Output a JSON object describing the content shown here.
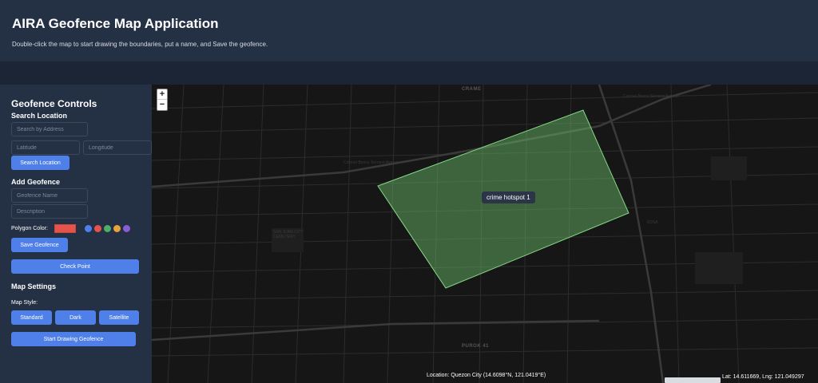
{
  "header": {
    "title": "AIRA Geofence Map Application",
    "subtitle": "Double-click the map to start drawing the boundaries, put a name, and Save the geofence."
  },
  "sidebar": {
    "title": "Geofence Controls",
    "search": {
      "heading": "Search Location",
      "address_placeholder": "Search by Address",
      "latitude_placeholder": "Latitude",
      "longitude_placeholder": "Longitude",
      "button": "Search Location"
    },
    "add": {
      "heading": "Add Geofence",
      "name_placeholder": "Geofence Name",
      "description_placeholder": "Description",
      "color_label": "Polygon Color:",
      "selected_color": "#e5534b",
      "palette": [
        "#4f80ea",
        "#e5534b",
        "#4caf6a",
        "#e9a33b",
        "#8a5cd6"
      ],
      "save_button": "Save Geofence",
      "check_button": "Check Point"
    },
    "settings": {
      "heading": "Map Settings",
      "style_label": "Map Style:",
      "styles": [
        "Standard",
        "Dark",
        "Satellite"
      ],
      "draw_button": "Start Drawing Geofence"
    }
  },
  "map": {
    "zoom_in": "+",
    "zoom_out": "−",
    "polygon_label": "crime hotspot 1",
    "polygon_fill": "#6fc36f",
    "location_text": "Location: Quezon City (14.6098°N, 121.0419°E)",
    "cursor_text": "Lat: 14.611669, Lng: 121.049297",
    "place_labels": [
      "CRAME",
      "PUROK 41",
      "SAN JUAN CITY CEMETERY"
    ],
    "street_labels": [
      "Colonel Bonny Serrano Avenue",
      "Colonel Bonny Serrano Avenue",
      "EDSA"
    ]
  }
}
